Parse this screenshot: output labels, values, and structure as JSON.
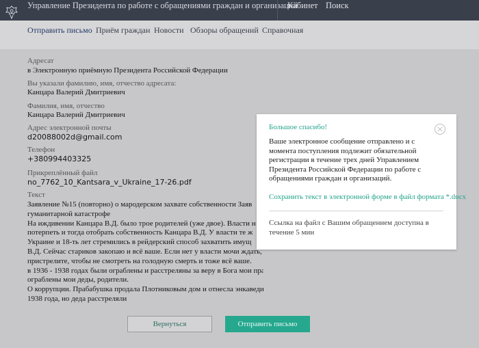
{
  "header": {
    "title": "Управление Президента по работе с обращениями граждан и организаций",
    "cabinet": "Кабинет",
    "search": "Поиск"
  },
  "nav": {
    "items": [
      "Отправить письмо",
      "Приём граждан",
      "Новости",
      "Обзоры обращений",
      "Справочная"
    ],
    "active_index": 0
  },
  "form": {
    "addressee_label": "Адресат",
    "addressee_value": "в Электронную приёмную Президента Российской Федерации",
    "surname_label": "Вы указали фамилию, имя, отчество адресата:",
    "surname_value": "Канцара Валерий Дмитриевич",
    "name_label": "Фамилия, имя, отчество",
    "name_value": "Канцара Валерий Дмитриевич",
    "email_label": "Адрес электронной почты",
    "email_value": "d20088002d@gmail.com",
    "phone_label": "Телефон",
    "phone_value": "+380994403325",
    "file_label": "Прикреплённый файл",
    "file_value": "no_7762_10_Kantsara_v_Ukraine_17-26.pdf",
    "text_label": "Текст",
    "text_lines": [
      "Заявление №15 (повторно) о мародерском захвате собственности Заяв",
      "гуманитарной катастрофе",
      "На иждивении Канцара В.Д. было трое родителей (уже двое). Власти н",
      "потерпеть и тогда отобрать собственность Канцара В.Д. У власти те ж",
      "Украине и 18-ть лет стремились в рейдерский способ захватить имущ",
      "В.Д. Сейчас стариков закопаю и всё ваше. Если нет у власти мочи ждать, просто",
      "пристрелите, чтобы не смотреть на голодную смерть и тоже всё ваше.",
      "в 1936 - 1938 годах были ограблены и расстреляны за веру в Бога мои прадеды,",
      "ограблены мои деды, родители.",
      "О коррупции. Прабабушка продала Плотниковым дом и отнесла энкаведистам в июне",
      "1938 года, но деда расстреляли"
    ]
  },
  "buttons": {
    "back": "Вернуться",
    "send": "Отправить письмо"
  },
  "modal": {
    "title": "Большое спасибо!",
    "body": "Ваше электронное сообщение отправлено и с момента поступления подлежит обязательной регистрации в течение трех дней Управлением Президента Российской Федерации по работе с обращениями граждан и организаций.",
    "save_link": "Сохранить текст в электронной форме в файл формата *.docx",
    "note": "Ссылка на файл с Вашим обращением доступна в течение 5 мин"
  },
  "colors": {
    "header_bg": "#3a3f4c",
    "accent": "#26a88f",
    "overlay_bg": "#c7c7c9"
  }
}
